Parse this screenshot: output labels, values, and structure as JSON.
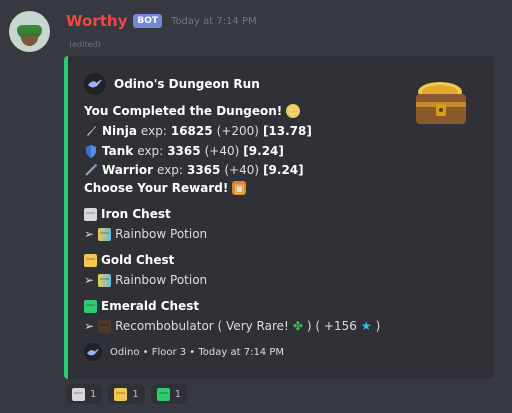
{
  "message": {
    "author": "Worthy",
    "bot_tag": "BOT",
    "timestamp": "Today at 7:14 PM",
    "edited": "(edited)"
  },
  "embed": {
    "accent": "#2ecc71",
    "author_name": "Odino's Dungeon Run",
    "title": "You Completed the Dungeon!",
    "lines": [
      {
        "icon": "sword-icon",
        "class": "Ninja",
        "label": "exp:",
        "value": "16825",
        "gain": "(+200)",
        "level": "[13.78]"
      },
      {
        "icon": "shield-icon",
        "class": "Tank",
        "label": "exp:",
        "value": "3365",
        "gain": "(+40)",
        "level": "[9.24]"
      },
      {
        "icon": "staff-icon",
        "class": "Warrior",
        "label": "exp:",
        "value": "3365",
        "gain": "(+40)",
        "level": "[9.24]"
      }
    ],
    "choose": "Choose Your Reward!",
    "rewards": [
      {
        "name": "Iron Chest",
        "arrow": "➢",
        "item": "Rainbow Potion",
        "color": "#d9d9d9"
      },
      {
        "name": "Gold Chest",
        "arrow": "➢",
        "item": "Rainbow Potion",
        "color": "#f2c94c"
      },
      {
        "name": "Emerald Chest",
        "arrow": "➢",
        "item": "Recombobulator ( Very Rare!",
        "suffix": ") ( +156",
        "end": ")",
        "color": "#2ecc71"
      }
    ],
    "footer": "Odino • Floor 3 • Today at 7:14 PM"
  },
  "reactions": [
    {
      "icon": "iron-box-icon",
      "count": "1",
      "color": "#d9d9d9"
    },
    {
      "icon": "gold-box-icon",
      "count": "1",
      "color": "#f2c94c"
    },
    {
      "icon": "emerald-box-icon",
      "count": "1",
      "color": "#2ecc71"
    }
  ]
}
